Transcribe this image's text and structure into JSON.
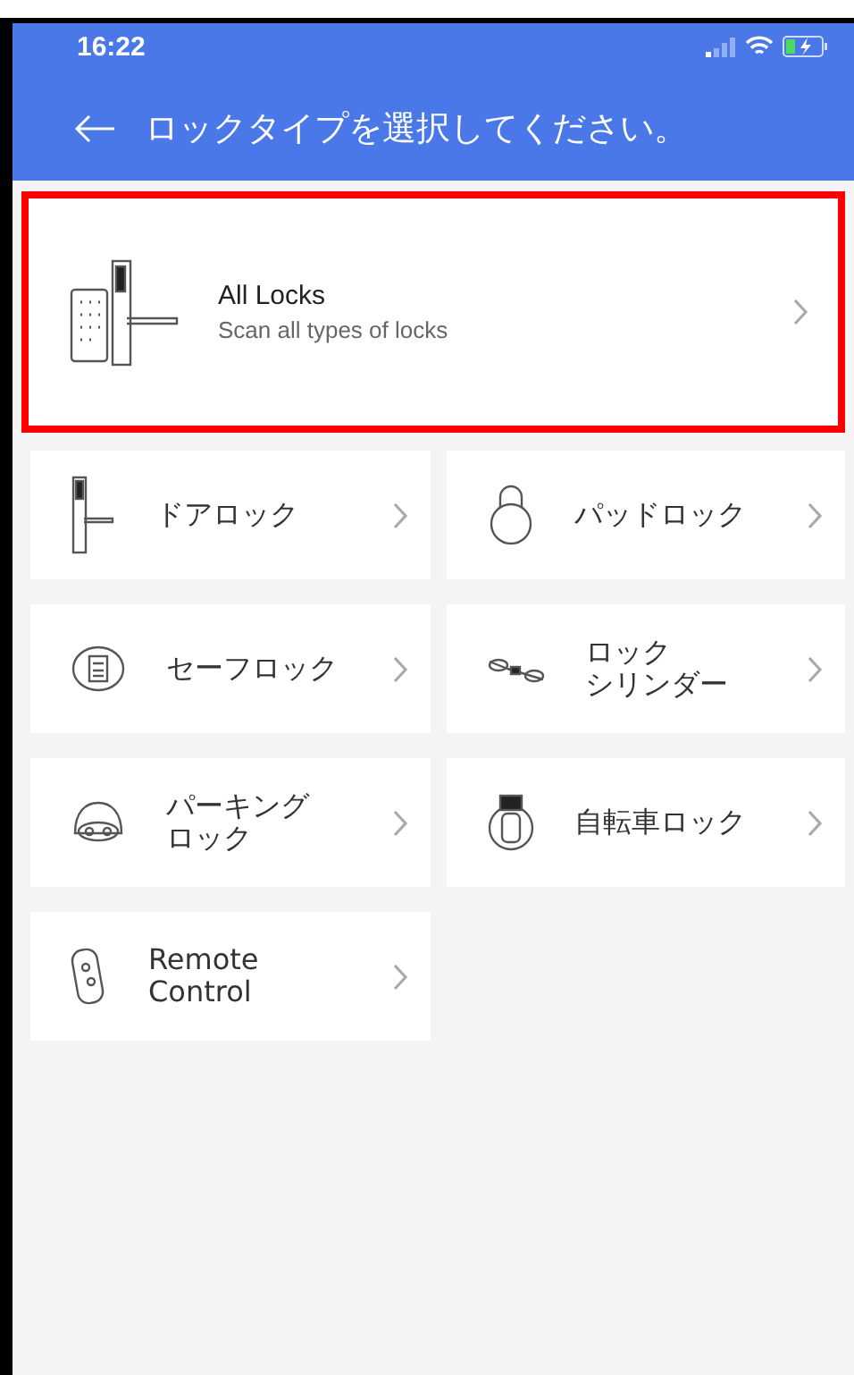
{
  "status_bar": {
    "time": "16:22"
  },
  "header": {
    "title": "ロックタイプを選択してください。"
  },
  "featured": {
    "title": "All Locks",
    "subtitle": "Scan all types of locks",
    "highlighted": true
  },
  "lock_types": [
    {
      "kind": "door",
      "label_lines": [
        "ドアロック"
      ]
    },
    {
      "kind": "padlock",
      "label_lines": [
        "パッドロック"
      ]
    },
    {
      "kind": "safe",
      "label_lines": [
        "セーフロック"
      ]
    },
    {
      "kind": "cylinder",
      "label_lines": [
        "ロック",
        "シリンダー"
      ]
    },
    {
      "kind": "parking",
      "label_lines": [
        "パーキング",
        "ロック"
      ]
    },
    {
      "kind": "bike",
      "label_lines": [
        "自転車ロック"
      ]
    },
    {
      "kind": "remote",
      "label_lines": [
        "Remote",
        "Control"
      ]
    }
  ]
}
